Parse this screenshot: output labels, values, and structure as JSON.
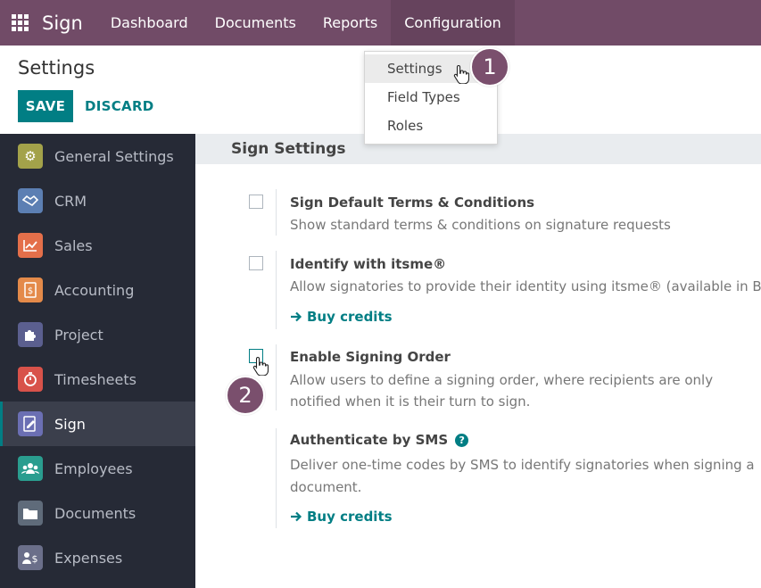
{
  "navbar": {
    "app_name": "Sign",
    "items": [
      "Dashboard",
      "Documents",
      "Reports",
      "Configuration"
    ]
  },
  "page": {
    "title": "Settings",
    "save_label": "SAVE",
    "discard_label": "DISCARD"
  },
  "dropdown": {
    "items": [
      "Settings",
      "Field Types",
      "Roles"
    ]
  },
  "steps": [
    "1",
    "2"
  ],
  "sidebar": {
    "items": [
      {
        "label": "General Settings",
        "icon": "gear-icon",
        "color": "#a3a24a"
      },
      {
        "label": "CRM",
        "icon": "handshake-icon",
        "color": "#5c7fb3"
      },
      {
        "label": "Sales",
        "icon": "chart-icon",
        "color": "#e46f4a"
      },
      {
        "label": "Accounting",
        "icon": "invoice-icon",
        "color": "#e48a4a"
      },
      {
        "label": "Project",
        "icon": "puzzle-icon",
        "color": "#5b5f8f"
      },
      {
        "label": "Timesheets",
        "icon": "stopwatch-icon",
        "color": "#d8524a"
      },
      {
        "label": "Sign",
        "icon": "sign-icon",
        "color": "#6b6fb3"
      },
      {
        "label": "Employees",
        "icon": "people-icon",
        "color": "#2a9d8f"
      },
      {
        "label": "Documents",
        "icon": "folder-icon",
        "color": "#5f6b7a"
      },
      {
        "label": "Expenses",
        "icon": "expense-icon",
        "color": "#6b6f8a"
      }
    ]
  },
  "main": {
    "section_title": "Sign Settings",
    "settings": [
      {
        "title": "Sign Default Terms & Conditions",
        "desc": [
          "Show standard terms & conditions on signature requests"
        ]
      },
      {
        "title": "Identify with itsme®",
        "desc": [
          "Allow signatories to provide their identity using itsme® (available in Belgium"
        ],
        "link": "Buy credits"
      },
      {
        "title": "Enable Signing Order",
        "desc": [
          "Allow users to define a signing order, where recipients are only",
          "notified when it is their turn to sign."
        ]
      },
      {
        "title": "Authenticate by SMS",
        "desc": [
          "Deliver one-time codes by SMS to identify signatories when signing a",
          "document."
        ],
        "link": "Buy credits"
      }
    ]
  }
}
